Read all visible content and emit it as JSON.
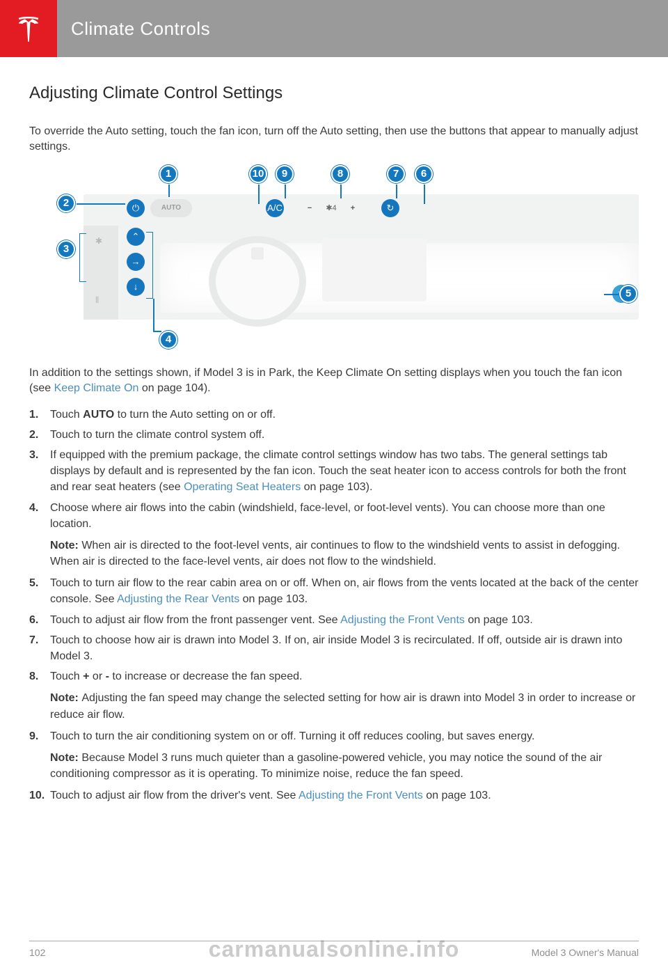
{
  "header": {
    "title": "Climate Controls"
  },
  "section_heading": "Adjusting Climate Control Settings",
  "intro": "To override the Auto setting, touch the fan icon, turn off the Auto setting, then use the buttons that appear to manually adjust settings.",
  "figure": {
    "callouts": {
      "c1": "1",
      "c2": "2",
      "c3": "3",
      "c4": "4",
      "c5": "5",
      "c6": "6",
      "c7": "7",
      "c8": "8",
      "c9": "9",
      "c10": "10"
    },
    "auto_label": "AUTO",
    "ac_label": "A/C",
    "fan_value": "4",
    "minus": "−",
    "plus": "+"
  },
  "para2_a": "In addition to the settings shown, if Model 3 is in Park, the Keep Climate On setting displays when you touch the fan icon (see ",
  "para2_link": "Keep Climate On",
  "para2_b": " on page 104).",
  "list": {
    "i1": {
      "n": "1.",
      "a": "Touch ",
      "b": "AUTO",
      "c": " to turn the Auto setting on or off."
    },
    "i2": {
      "n": "2.",
      "t": "Touch to turn the climate control system off."
    },
    "i3": {
      "n": "3.",
      "a": "If equipped with the premium package, the climate control settings window has two tabs. The general settings tab displays by default and is represented by the fan icon. Touch the seat heater icon to access controls for both the front and rear seat heaters (see ",
      "link": "Operating Seat Heaters",
      "b": " on page 103)."
    },
    "i4": {
      "n": "4.",
      "t": "Choose where air flows into the cabin (windshield, face-level, or foot-level vents). You can choose more than one location.",
      "note_label": "Note: ",
      "note": "When air is directed to the foot-level vents, air continues to flow to the windshield vents to assist in defogging. When air is directed to the face-level vents, air does not flow to the windshield."
    },
    "i5": {
      "n": "5.",
      "a": "Touch to turn air flow to the rear cabin area on or off. When on, air flows from the vents located at the back of the center console. See ",
      "link": "Adjusting the Rear Vents",
      "b": " on page 103."
    },
    "i6": {
      "n": "6.",
      "a": "Touch to adjust air flow from the front passenger vent. See ",
      "link": "Adjusting the Front Vents",
      "b": " on page 103."
    },
    "i7": {
      "n": "7.",
      "t": "Touch to choose how air is drawn into Model 3. If on, air inside Model 3 is recirculated. If off, outside air is drawn into Model 3."
    },
    "i8": {
      "n": "8.",
      "a": "Touch ",
      "b1": "+",
      "mid": " or ",
      "b2": "-",
      "c": " to increase or decrease the fan speed.",
      "note_label": "Note: ",
      "note": "Adjusting the fan speed may change the selected setting for how air is drawn into Model 3 in order to increase or reduce air flow."
    },
    "i9": {
      "n": "9.",
      "t": "Touch to turn the air conditioning system on or off. Turning it off reduces cooling, but saves energy.",
      "note_label": "Note: ",
      "note": "Because Model 3 runs much quieter than a gasoline-powered vehicle, you may notice the sound of the air conditioning compressor as it is operating. To minimize noise, reduce the fan speed."
    },
    "i10": {
      "n": "10.",
      "a": "Touch to adjust air flow from the driver's vent. See ",
      "link": "Adjusting the Front Vents",
      "b": " on page 103."
    }
  },
  "footer": {
    "page": "102",
    "right": "Model 3 Owner's Manual"
  },
  "watermark": "carmanualsonline.info"
}
